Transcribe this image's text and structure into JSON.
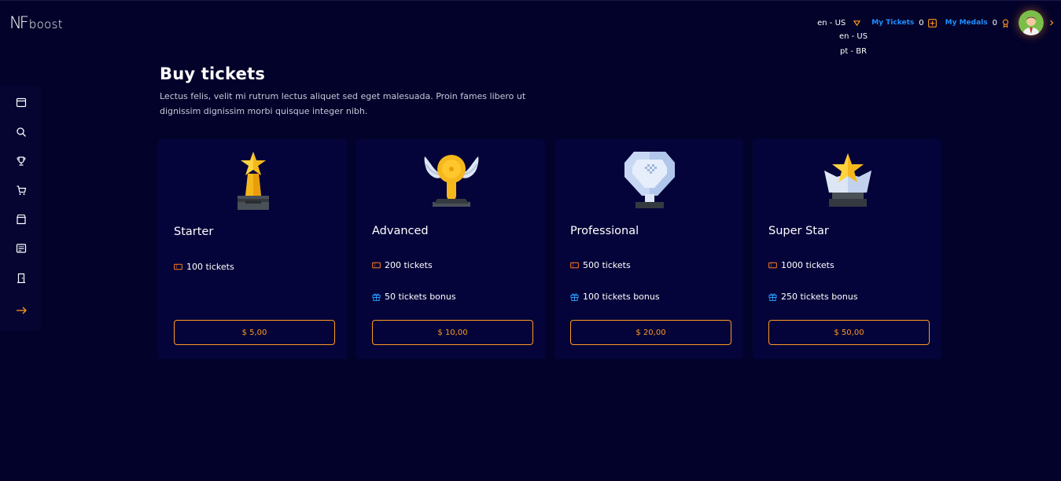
{
  "brand": {
    "logo_mark": "NF",
    "logo_text": "boost"
  },
  "header": {
    "language": "en - US",
    "tickets_label": "My Tickets",
    "tickets_count": "0",
    "medals_label": "My Medals",
    "medals_count": "0"
  },
  "language_menu": [
    "en - US",
    "pt - BR"
  ],
  "sidebar": {
    "items": [
      "calendar-icon",
      "search-icon",
      "trophy-icon",
      "cart-icon",
      "store-icon",
      "news-icon",
      "door-icon",
      "arrow-right-icon"
    ]
  },
  "main": {
    "title": "Buy tickets",
    "description": "Lectus felis, velit mi rutrum lectus aliquet sed eget malesuada. Proin fames libero ut dignissim dignissim morbi quisque integer nibh."
  },
  "packages": [
    {
      "name": "Starter",
      "tickets": "100 tickets",
      "bonus": "",
      "price": "$ 5,00",
      "icon": "gold-star-trophy-icon"
    },
    {
      "name": "Advanced",
      "tickets": "200 tickets",
      "bonus": "50 tickets bonus",
      "price": "$ 10,00",
      "icon": "winged-medal-trophy-icon"
    },
    {
      "name": "Professional",
      "tickets": "500 tickets",
      "bonus": "100 tickets bonus",
      "price": "$ 20,00",
      "icon": "diamond-trophy-icon"
    },
    {
      "name": "Super Star",
      "tickets": "1000 tickets",
      "bonus": "250 tickets bonus",
      "price": "$ 50,00",
      "icon": "crystal-star-trophy-icon"
    }
  ],
  "colors": {
    "background": "#03022a",
    "card": "#05043a",
    "accent": "#ff9a1f",
    "link": "#1e8fff",
    "gift": "#2aa0ff"
  }
}
